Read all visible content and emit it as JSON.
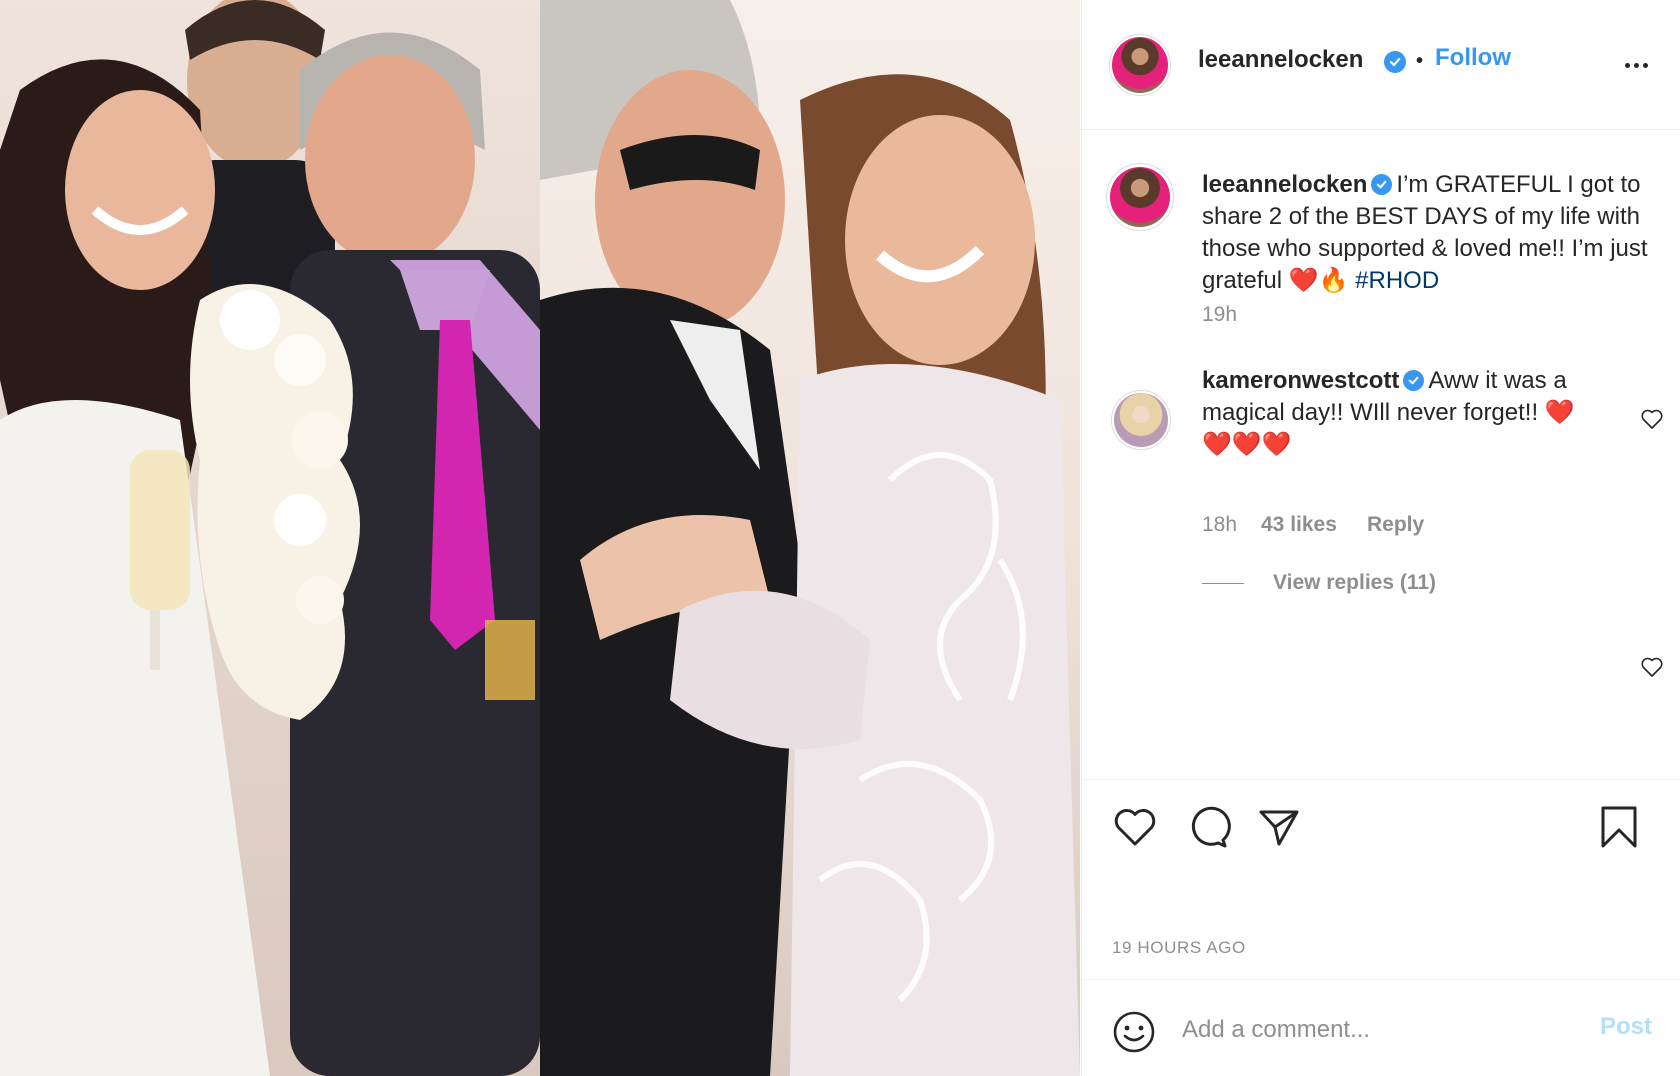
{
  "post": {
    "username": "leeannelocken",
    "follow_label": "Follow",
    "separator": "•",
    "more_icon": "more-horizontal-icon"
  },
  "caption": {
    "username": "leeannelocken",
    "text": "I’m GRATEFUL I got to share 2 of the BEST DAYS of my life with those who supported & loved me!! I’m just grateful ",
    "emoji": "❤️🔥",
    "hashtag": "#RHOD",
    "time": "19h"
  },
  "comment": {
    "username": "kameronwestcott",
    "text": "Aww it was a magical day!! WIll never forget!! ❤️",
    "text_line2": "❤️❤️❤️",
    "time": "18h",
    "likes": "43 likes",
    "reply_label": "Reply",
    "view_replies": "View replies (11)"
  },
  "actions": {
    "like": "heart-icon",
    "comment": "comment-bubble-icon",
    "share": "paper-plane-icon",
    "save": "bookmark-icon"
  },
  "timestamp": "19 HOURS AGO",
  "add_comment": {
    "placeholder": "Add a comment...",
    "post_label": "Post"
  },
  "colors": {
    "accent": "#3897f0",
    "muted": "#8e8e8e",
    "post_disabled": "#b2dffc",
    "hashtag": "#00376b"
  }
}
